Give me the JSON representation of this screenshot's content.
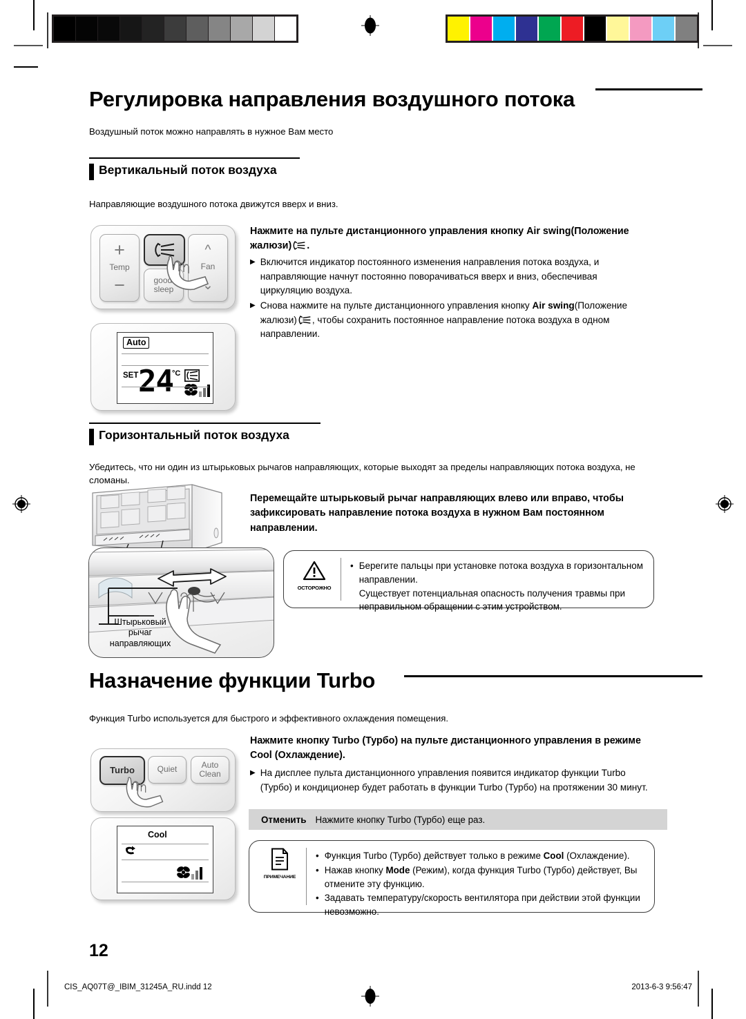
{
  "document": {
    "page_number": "12",
    "footer_file": "CIS_AQ07T@_IBIM_31245A_RU.indd   12",
    "footer_date": "2013-6-3   9:56:47"
  },
  "calibration": {
    "grayscale": [
      "#000000",
      "#040404",
      "#090909",
      "#161616",
      "#232323",
      "#3c3c3c",
      "#5e5e5e",
      "#858585",
      "#a8a8a8",
      "#d3d3d3",
      "#ffffff"
    ],
    "colors": [
      "#fff200",
      "#ec008c",
      "#00aeef",
      "#2e3192",
      "#00a651",
      "#ed1c24",
      "#000000",
      "#fff799",
      "#f49ac1",
      "#6dcff6",
      "#808080"
    ]
  },
  "section1": {
    "title": "Регулировка направления воздушного потока",
    "subtitle": "Воздушный поток можно направлять в нужное Вам место",
    "sub1": {
      "heading": "Вертикальный поток воздуха",
      "lead": "Направляющие воздушного потока движутся вверх и вниз.",
      "instruction_pre": "Нажмите на пульте дистанционного управления кнопку ",
      "instruction_bold": "Air swing",
      "instruction_post": "(Положение жалюзи)",
      "instruction_end": ".",
      "bullets": [
        "Включится индикатор постоянного изменения направления потока воздуха, и направляющие начнут постоянно поворачиваться вверх и вниз, обеспечивая циркуляцию воздуха.",
        "Снова нажмите на пульте дистанционного управления кнопку "
      ],
      "bullet2_bold": "Air swing",
      "bullet2_mid": "(Положение жалюзи)",
      "bullet2_tail": ", чтобы сохранить постоянное направление потока воздуха в одном направлении.",
      "remote": {
        "temp_label": "Temp",
        "plus": "+",
        "minus": "−",
        "fan_label": "Fan",
        "goodsleep_line1": "good'",
        "goodsleep_line2": "sleep",
        "airswing_button": "air-swing"
      },
      "display": {
        "mode": "Auto",
        "set_label": "SET",
        "temperature": "24",
        "unit": "°C"
      }
    },
    "sub2": {
      "heading": "Горизонтальный поток воздуха",
      "lead": "Убедитесь, что ни один из штырьковых рычагов направляющих, которые выходят за пределы направляющих потока воздуха, не сломаны.",
      "instruction": "Перемещайте штырьковый рычаг направляющих влево или вправо, чтобы зафиксировать направление потока воздуха в нужном Вам постоянном направлении.",
      "callout_label": "Штырьковый\nрычаг\nнаправляющих",
      "caution": {
        "icon_label": "ОСТОРОЖНО",
        "items": [
          "Берегите пальцы при установке потока воздуха в горизонтальном направлении.\nСуществует потенциальная опасность получения травмы при неправильном обращении с этим устройством."
        ]
      }
    }
  },
  "section2": {
    "title": "Назначение функции Turbo",
    "subtitle": "Функция Turbo используется для быстрого и эффективного охлаждения помещения.",
    "instruction_line1": "Нажмите кнопку Turbo (Турбо) на пульте дистанционного управления в режиме",
    "instruction_line2": "Cool (Охлаждение).",
    "bullet": "На дисплее пульта дистанционного управления появится индикатор функции Turbo (Турбо) и кондиционер будет работать в функции Turbo (Турбо) на протяжении 30 минут.",
    "cancel": {
      "label": "Отменить",
      "text": "Нажмите кнопку Turbo (Турбо) еще раз."
    },
    "remote": {
      "turbo": "Turbo",
      "quiet": "Quiet",
      "autoclean_line1": "Auto",
      "autoclean_line2": "Clean"
    },
    "display": {
      "mode": "Cool"
    },
    "note": {
      "icon_label": "ПРИМЕЧАНИЕ",
      "item1_pre": "Функция Turbo (Турбо) действует только в режиме ",
      "item1_bold": "Cool",
      "item1_post": " (Охлаждение).",
      "item2_pre": "Нажав кнопку ",
      "item2_bold": "Mode",
      "item2_post": " (Режим), когда функция Turbo (Турбо) действует, Вы отмените эту функцию.",
      "item3": "Задавать температуру/скорость вентилятора при действии этой функции невозможно."
    }
  }
}
